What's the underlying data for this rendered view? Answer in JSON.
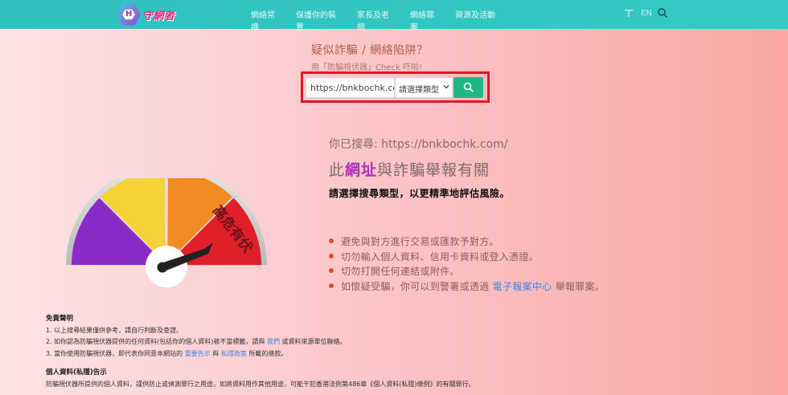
{
  "header": {
    "logo_text": "守網者",
    "logo_mark": "H",
    "nav": [
      "網絡常識",
      "保護你的裝置",
      "家長及老師",
      "網絡罪案",
      "資源及活動"
    ],
    "lang_label": "EN"
  },
  "search": {
    "title": "疑似詐騙 / 網絡陷阱？",
    "subtitle": "用「防騙視伏器」Check 吓啦!",
    "input_value": "https://bnkbochk.com/",
    "type_selected": "請選擇類型"
  },
  "gauge": {
    "label": "高危有伏",
    "level": "high",
    "colors": [
      "#8b2bc6",
      "#f3d23a",
      "#f28b23",
      "#df1f2a"
    ]
  },
  "result": {
    "searched_prefix": "你已搜尋: ",
    "searched_value": "https://bnkbochk.com/",
    "verdict_pre": "此",
    "verdict_highlight": "網址",
    "verdict_post": "與詐騙舉報有關",
    "instruction": "請選擇搜尋類型，以更精準地評估風險。",
    "tips": [
      "避免與對方進行交易或匯款予對方。",
      "切勿輸入個人資料、信用卡資料或登入憑證。",
      "切勿打開任何連結或附件。"
    ],
    "tip4_pre": "如懷疑受騙，你可以到警署或透過",
    "tip4_link": "電子報案中心",
    "tip4_post": "舉報罪案。"
  },
  "disclaimer": {
    "title": "免責聲明",
    "line1": "1. 以上搜尋結果僅供參考，請自行判斷及查證。",
    "line2_pre": "2. 如你認為防騙視伏器提供的任何資料(包括你的個人資料)被不當標籤，請與",
    "line2_link": "我們",
    "line2_post": "或資料來源單位聯絡。",
    "line3_pre": "3. 當你使用防騙視伏器，即代表你同意本網站的",
    "line3_link1": "重要告示",
    "line3_mid": "與",
    "line3_link2": "私隱政策",
    "line3_post": "所載的條款。"
  },
  "privacy": {
    "title": "個人資料(私隱)告示",
    "line1": "防騙視伏器所提供的個人資料，謹供防止或偵測罪行之用途，如將資料用作其他用途，可能干犯香港法例第486章《個人資料(私隱)條例》的有關罪行。"
  }
}
